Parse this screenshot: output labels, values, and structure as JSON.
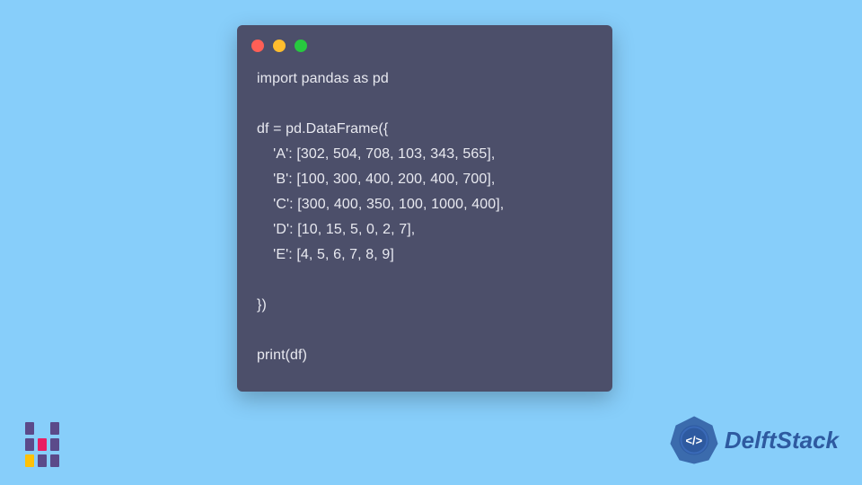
{
  "code_lines": "import pandas as pd\n\ndf = pd.DataFrame({\n    'A': [302, 504, 708, 103, 343, 565],\n    'B': [100, 300, 400, 200, 400, 700],\n    'C': [300, 400, 350, 100, 1000, 400],\n    'D': [10, 15, 5, 0, 2, 7],\n    'E': [4, 5, 6, 7, 8, 9]\n\n})\n\nprint(df)",
  "brand": {
    "name": "DelftStack",
    "badge_text": "</>"
  },
  "window_dots": [
    "red",
    "yellow",
    "green"
  ]
}
